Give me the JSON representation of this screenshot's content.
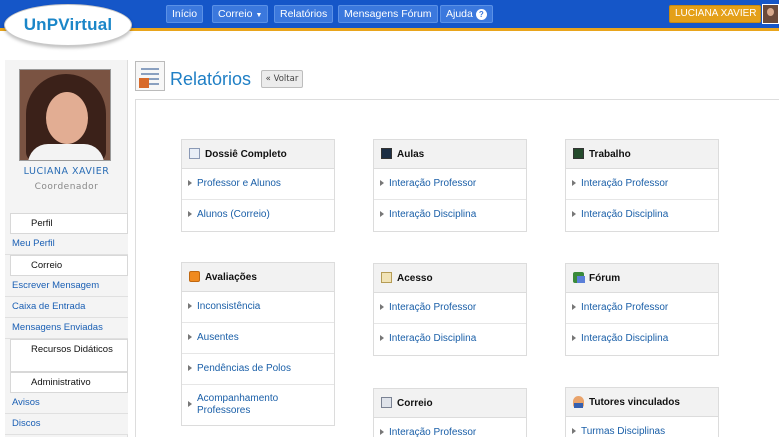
{
  "app": {
    "logo_text": "UnPVirtual"
  },
  "nav": {
    "inicio": "Início",
    "correio": "Correio",
    "relatorios": "Relatórios",
    "mensagens_forum": "Mensagens Fórum",
    "ajuda": "Ajuda",
    "ajuda_badge": "?",
    "caret": "▼",
    "user": "LUCIANA XAVIER"
  },
  "profile": {
    "name": "LUCIANA XAVIER",
    "role": "Coordenador"
  },
  "sidebar": {
    "items": [
      {
        "label": "Perfil",
        "kind": "header"
      },
      {
        "label": "Meu Perfil",
        "kind": "link"
      },
      {
        "label": "Correio",
        "kind": "header"
      },
      {
        "label": "Escrever Mensagem",
        "kind": "link"
      },
      {
        "label": "Caixa de Entrada",
        "kind": "link"
      },
      {
        "label": "Mensagens Enviadas",
        "kind": "link"
      },
      {
        "label": "Recursos Didáticos",
        "kind": "header"
      },
      {
        "label": "Administrativo",
        "kind": "header"
      },
      {
        "label": "Avisos",
        "kind": "link"
      },
      {
        "label": "Discos",
        "kind": "link"
      }
    ]
  },
  "page": {
    "title": "Relatórios",
    "back_label": "« Voltar"
  },
  "cards": {
    "dossie": {
      "title": "Dossiê Completo",
      "items": [
        "Professor e Alunos",
        "Alunos (Correio)"
      ]
    },
    "aulas": {
      "title": "Aulas",
      "items": [
        "Interação Professor",
        "Interação Disciplina"
      ]
    },
    "trabalho": {
      "title": "Trabalho",
      "items": [
        "Interação Professor",
        "Interação Disciplina"
      ]
    },
    "avaliacoes": {
      "title": "Avaliações",
      "items": [
        "Inconsistência",
        "Ausentes",
        "Pendências de Polos",
        "Acompanhamento Professores"
      ]
    },
    "acesso": {
      "title": "Acesso",
      "items": [
        "Interação Professor",
        "Interação Disciplina"
      ]
    },
    "forum": {
      "title": "Fórum",
      "items": [
        "Interação Professor",
        "Interação Disciplina"
      ]
    },
    "correio": {
      "title": "Correio",
      "items": [
        "Interação Professor"
      ]
    },
    "tutores": {
      "title": "Tutores vinculados",
      "items": [
        "Turmas Disciplinas"
      ]
    }
  },
  "colors": {
    "topbar": "#1556c8",
    "accent": "#e9a51c",
    "link": "#1a5fa8",
    "title": "#1f7fc5"
  },
  "icons": {
    "dossie": "document-icon",
    "aulas": "monitor-icon",
    "trabalho": "book-icon",
    "avaliacoes": "clipboard-icon",
    "acesso": "key-document-icon",
    "forum": "chat-icon",
    "correio": "envelope-icon",
    "tutores": "person-icon"
  }
}
